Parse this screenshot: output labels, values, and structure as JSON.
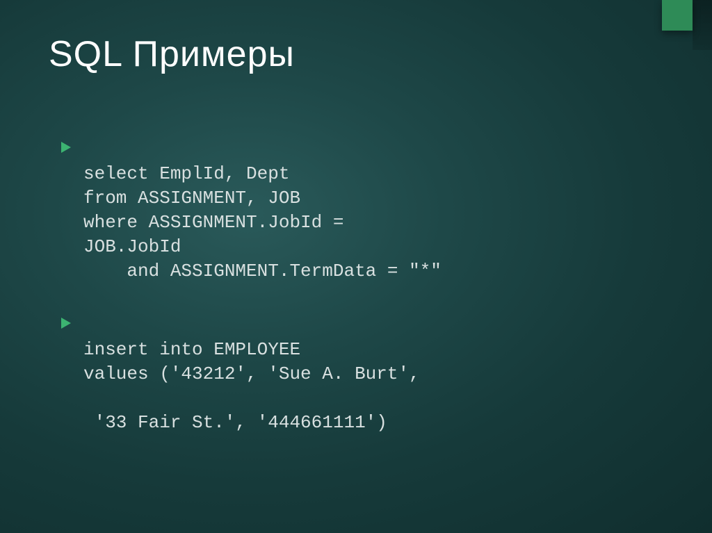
{
  "slide": {
    "title": "SQL Примеры",
    "items": [
      {
        "lines": [
          "select EmplId, Dept",
          "from ASSIGNMENT, JOB",
          "where ASSIGNMENT.JobId =",
          "JOB.JobId",
          "    and ASSIGNMENT.TermData = \"*\""
        ]
      },
      {
        "lines": [
          "insert into EMPLOYEE",
          "values ('43212', 'Sue A. Burt',",
          " '33 Fair St.', '444661111')"
        ]
      }
    ]
  },
  "accent_color": "#2e8b57",
  "bullet_color": "#3cb371"
}
